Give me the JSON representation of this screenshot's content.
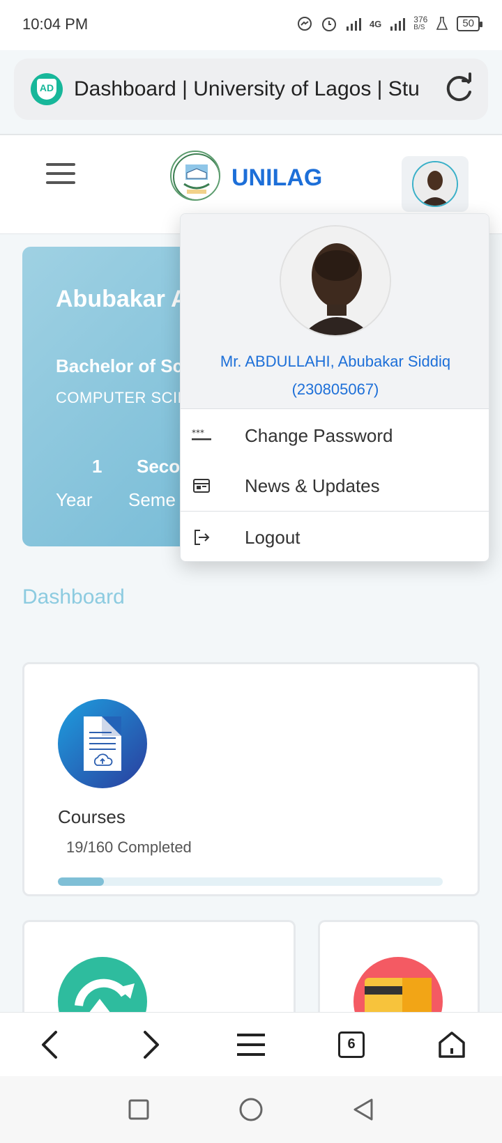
{
  "status_bar": {
    "time": "10:04 PM",
    "network": "4G",
    "speed_value": "376",
    "speed_unit": "B/S",
    "battery": "50"
  },
  "browser": {
    "url_title": "Dashboard | University of Lagos | Stu",
    "adblock_label": "AD",
    "tab_count": "6"
  },
  "header": {
    "brand": "UNILAG"
  },
  "welcome": {
    "name": "Abubakar A",
    "degree": "Bachelor of Sc",
    "department": "COMPUTER SCIE",
    "year_value": "1",
    "year_label": "Year",
    "semester_value": "Seco",
    "semester_label": "Seme"
  },
  "dashboard_title": "Dashboard",
  "courses_card": {
    "title": "Courses",
    "subtitle": "19/160 Completed",
    "progress_fraction": 0.119
  },
  "profile_menu": {
    "name_line1": "Mr. ABDULLAHI, Abubakar Siddiq",
    "name_line2": "(230805067)",
    "items": [
      {
        "label": "Change Password",
        "icon": "password-icon"
      },
      {
        "label": "News & Updates",
        "icon": "news-icon"
      },
      {
        "label": "Logout",
        "icon": "logout-icon"
      }
    ]
  },
  "colors": {
    "brand_blue": "#1d6fd8",
    "welcome_gradient": "#6fb7d4",
    "dashboard_title": "#8ccbe0",
    "adblock_green": "#17b79a"
  }
}
